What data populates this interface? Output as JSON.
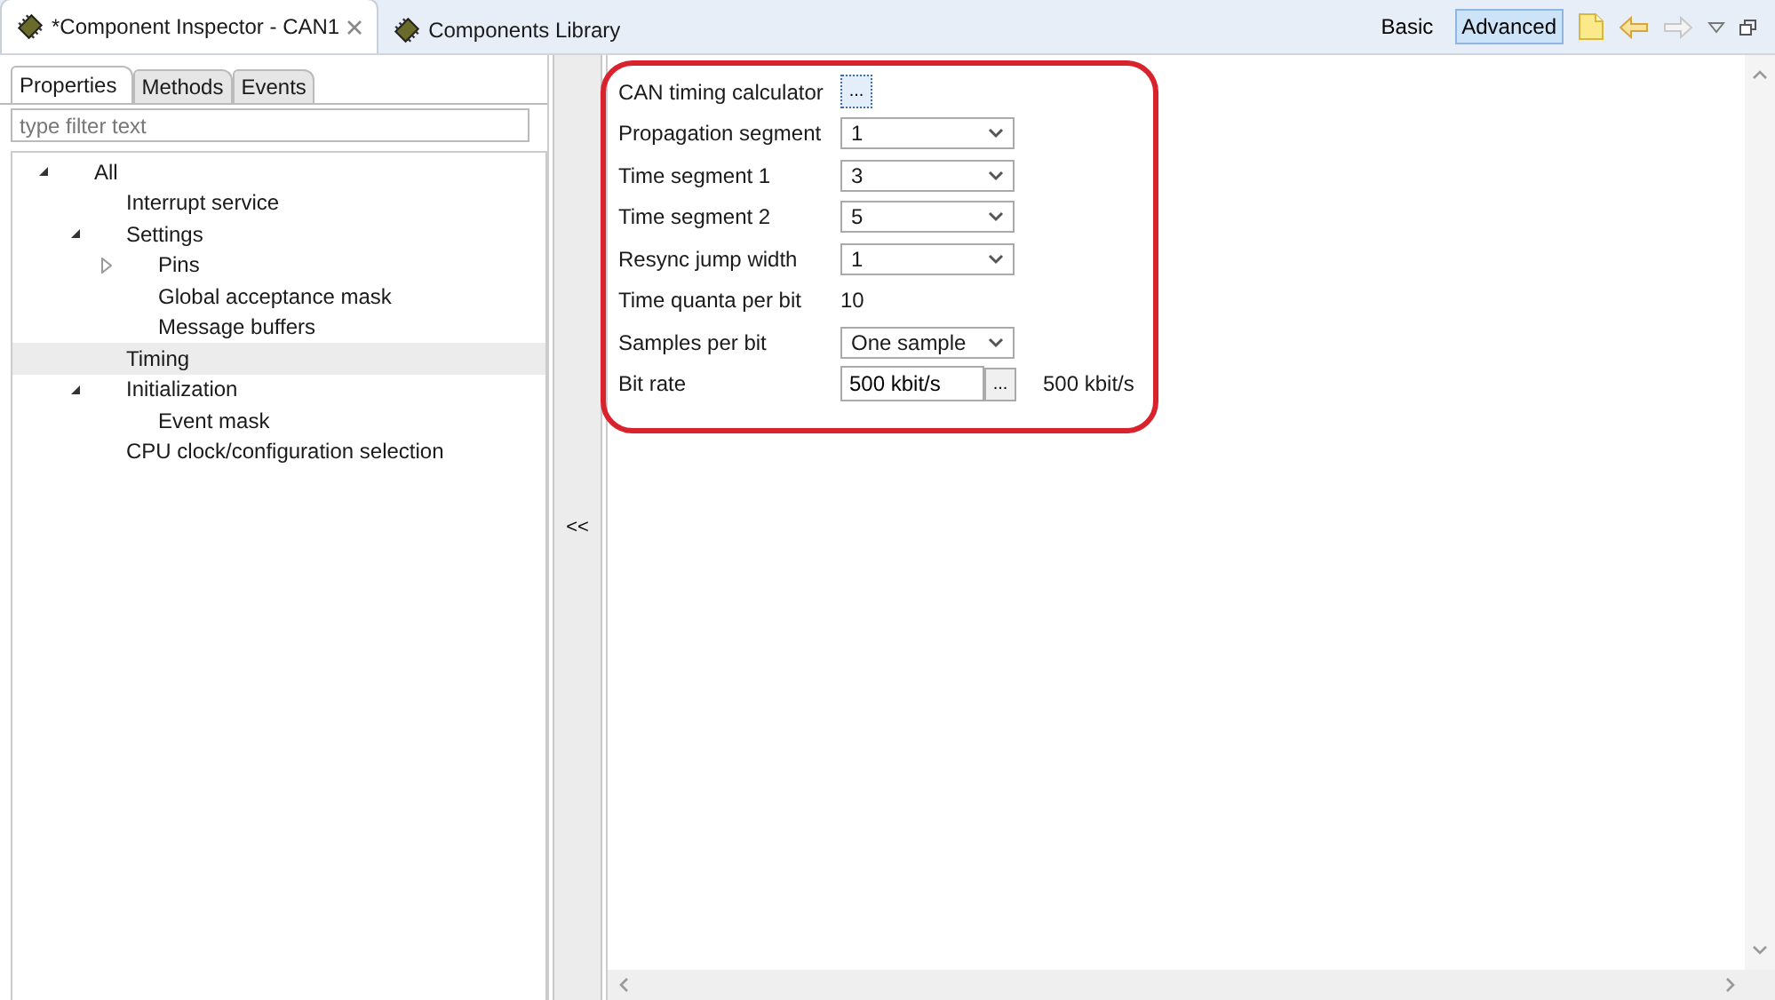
{
  "editor_tabs": [
    {
      "label": "*Component Inspector - CAN1",
      "selected": true
    },
    {
      "label": "Components Library",
      "selected": false
    }
  ],
  "view_modes": [
    {
      "label": "Basic",
      "selected": false
    },
    {
      "label": "Advanced",
      "selected": true
    }
  ],
  "sub_tabs": [
    {
      "label": "Properties",
      "selected": true
    },
    {
      "label": "Methods",
      "selected": false
    },
    {
      "label": "Events",
      "selected": false
    }
  ],
  "filter": {
    "placeholder": "type filter text"
  },
  "tree": [
    {
      "label": "All",
      "expanded": true,
      "selected": false,
      "children": [
        {
          "label": "Interrupt service",
          "selected": false
        },
        {
          "label": "Settings",
          "expanded": true,
          "selected": false,
          "children": [
            {
              "label": "Pins",
              "expanded": false,
              "selected": false
            },
            {
              "label": "Global acceptance mask",
              "selected": false
            },
            {
              "label": "Message buffers",
              "selected": false
            }
          ]
        },
        {
          "label": "Timing",
          "selected": true
        },
        {
          "label": "Initialization",
          "expanded": true,
          "selected": false,
          "children": [
            {
              "label": "Event mask",
              "selected": false
            }
          ]
        },
        {
          "label": "CPU clock/configuration selection",
          "selected": false
        }
      ]
    }
  ],
  "collapse_button": "<<",
  "properties": [
    {
      "kind": "button",
      "label": "CAN timing calculator",
      "button": "..."
    },
    {
      "kind": "select",
      "label": "Propagation segment",
      "value": "1"
    },
    {
      "kind": "select",
      "label": "Time segment 1",
      "value": "3"
    },
    {
      "kind": "select",
      "label": "Time segment 2",
      "value": "5"
    },
    {
      "kind": "select",
      "label": "Resync jump width",
      "value": "1"
    },
    {
      "kind": "text",
      "label": "Time quanta per bit",
      "value": "10"
    },
    {
      "kind": "select",
      "label": "Samples per bit",
      "value": "One sample"
    },
    {
      "kind": "input_button",
      "label": "Bit rate",
      "value": "500 kbit/s",
      "button": "...",
      "result": "500 kbit/s"
    }
  ]
}
